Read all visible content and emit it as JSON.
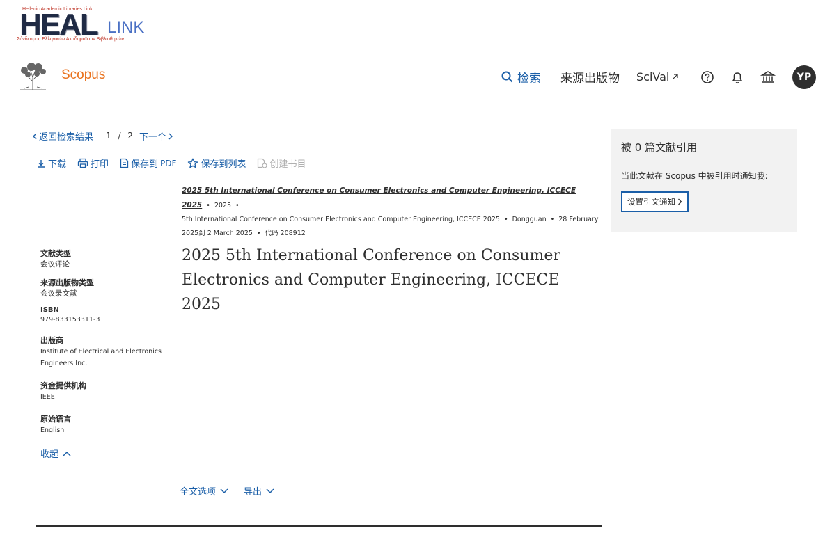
{
  "heal_logo": {
    "tagline": "Hellenic Academic Libraries Link",
    "big": "HEAL",
    "link": "LINK",
    "greek": "Σύνδεσμος Ελληνικών Ακαδημαϊκών Βιβλιοθηκών"
  },
  "header": {
    "brand": "Scopus",
    "search": "检索",
    "sources": "来源出版物",
    "scival": "SciVal",
    "avatar_initials": "YP"
  },
  "navigation": {
    "back": "返回检索结果",
    "pager_current": "1",
    "pager_sep": "/",
    "pager_total": "2",
    "next": "下一个"
  },
  "actions": {
    "download": "下载",
    "print": "打印",
    "save_pdf": "保存到",
    "save_pdf_suffix": "PDF",
    "save_list": "保存到列表",
    "create_bib": "创建书目"
  },
  "source": {
    "title": "2025 5th International Conference on Consumer Electronics and Computer Engineering, ICCECE 2025",
    "year": "2025",
    "conference": "5th International Conference on Consumer Electronics and Computer Engineering, ICCECE 2025",
    "location": "Dongguan",
    "dates": "28 February 2025到 2 March 2025",
    "code": "代码 208912"
  },
  "document_title": "2025 5th International Conference on Consumer Electronics and Computer Engineering, ICCECE 2025",
  "metadata": [
    {
      "label": "文献类型",
      "value": "会议评论"
    },
    {
      "label": "来源出版物类型",
      "value": "会议录文献"
    },
    {
      "label": "ISBN",
      "value": "979-833153311-3"
    },
    {
      "label": "出版商",
      "value": "Institute of Electrical and Electronics Engineers Inc."
    },
    {
      "label": "资金提供机构",
      "value": "IEEE"
    },
    {
      "label": "原始语言",
      "value": "English"
    }
  ],
  "collapse": "收起",
  "options": {
    "fulltext": "全文选项",
    "export": "导出"
  },
  "citations": {
    "title": "被 0 篇文献引用",
    "notify": "当此文献在 Scopus 中被引用时通知我:",
    "button": "设置引文通知"
  }
}
